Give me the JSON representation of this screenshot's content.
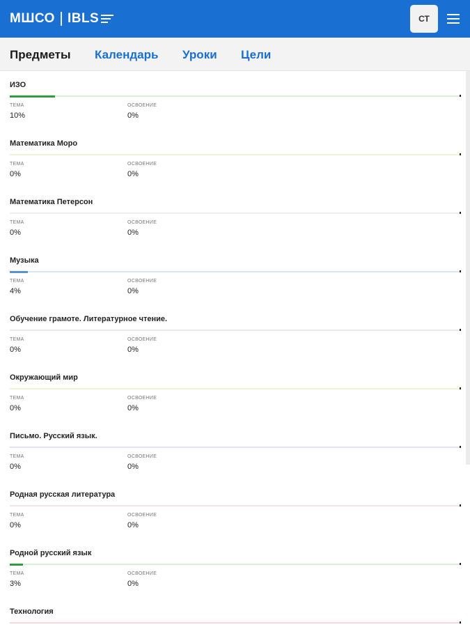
{
  "header": {
    "logo_left": "МШСО",
    "logo_right": "IBLS",
    "avatar_initials": "СТ",
    "accent_color": "#1a6fd2",
    "menu_icon": "hamburger-menu-icon"
  },
  "tabs": [
    {
      "label": "Предметы",
      "active": true
    },
    {
      "label": "Календарь",
      "active": false
    },
    {
      "label": "Уроки",
      "active": false
    },
    {
      "label": "Цели",
      "active": false
    }
  ],
  "labels": {
    "topic": "ТЕМА",
    "mastery": "ОСВОЕНИЕ"
  },
  "subjects": [
    {
      "name": "ИЗО",
      "topic": "10%",
      "mastery": "0%",
      "progress": 0.1,
      "color": "#2e9e3f",
      "track": "#d9efd9"
    },
    {
      "name": "Математика Моро",
      "topic": "0%",
      "mastery": "0%",
      "progress": 0.0,
      "color": "#d8d86a",
      "track": "#f3f3d8"
    },
    {
      "name": "Математика Петерсон",
      "topic": "0%",
      "mastery": "0%",
      "progress": 0.0,
      "color": "#cfcfcf",
      "track": "#eeeeee"
    },
    {
      "name": "Музыка",
      "topic": "4%",
      "mastery": "0%",
      "progress": 0.04,
      "color": "#5b8fd6",
      "track": "#d9e6f6"
    },
    {
      "name": "Обучение грамоте. Литературное чтение.",
      "topic": "0%",
      "mastery": "0%",
      "progress": 0.0,
      "color": "#cfcfcf",
      "track": "#e9e9e9"
    },
    {
      "name": "Окружающий мир",
      "topic": "0%",
      "mastery": "0%",
      "progress": 0.0,
      "color": "#d6e86a",
      "track": "#f0f6d2"
    },
    {
      "name": "Письмо. Русский язык.",
      "topic": "0%",
      "mastery": "0%",
      "progress": 0.0,
      "color": "#b8a8e6",
      "track": "#e8e2f6"
    },
    {
      "name": "Родная русская литература",
      "topic": "0%",
      "mastery": "0%",
      "progress": 0.0,
      "color": "#e6a8d8",
      "track": "#f6e2f0"
    },
    {
      "name": "Родной русский язык",
      "topic": "3%",
      "mastery": "0%",
      "progress": 0.03,
      "color": "#2e9e3f",
      "track": "#d9efd9"
    },
    {
      "name": "Технология",
      "topic": "",
      "mastery": "",
      "progress": 0.0,
      "color": "#e08080",
      "track": "#f6dada"
    }
  ]
}
